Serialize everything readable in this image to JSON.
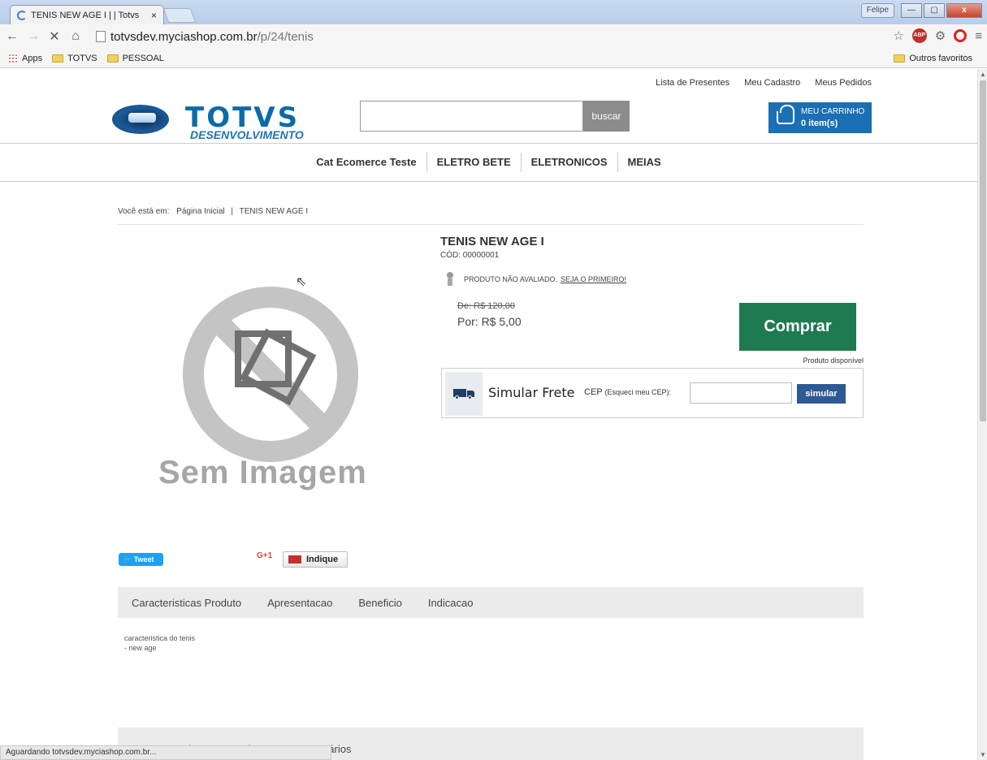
{
  "browser": {
    "tab_title": "TENIS NEW AGE I | | Totvs",
    "tab_close": "×",
    "user_button": "Felipe",
    "url_host": "totvsdev.myciashop.com.br",
    "url_path": "/p/24/tenis",
    "bookmarks": [
      "Apps",
      "TOTVS",
      "PESSOAL"
    ],
    "other_bookmarks": "Outros favoritos",
    "abp_label": "ABP",
    "status": "Aguardando totvsdev.myciashop.com.br..."
  },
  "header": {
    "links": [
      "Lista de Presentes",
      "Meu Cadastro",
      "Meus Pedidos"
    ],
    "logo_text": "TOTVS",
    "logo_sub": "DESENVOLVIMENTO",
    "search_value": "",
    "search_button": "buscar",
    "cart_title": "MEU CARRINHO",
    "cart_count": "0 item(s)"
  },
  "menu": [
    "Cat Ecomerce Teste",
    "ELETRO BETE",
    "ELETRONICOS",
    "MEIAS"
  ],
  "breadcrumb": {
    "prefix": "Você está em:",
    "home": "Página Inicial",
    "sep": "|",
    "current": "TENIS NEW AGE I"
  },
  "product": {
    "image_text": "Sem Imagem",
    "title": "TENIS NEW AGE I",
    "code": "CÓD: 00000001",
    "rating_text": "PRODUTO NÃO AVALIADO.",
    "rating_link": "SEJA O PRIMEIRO!",
    "price_old": "De: R$ 120,00",
    "price_new": "Por: R$ 5,00",
    "buy_button": "Comprar",
    "availability": "Produto disponível"
  },
  "shipping": {
    "title": "Simular Frete",
    "cep_label": "CEP",
    "cep_forgot": "(Esqueci meu CEP):",
    "cep_value": "",
    "button": "simular"
  },
  "social": {
    "tweet": "Tweet",
    "gplus": "G+1",
    "indique": "Indique"
  },
  "tabs": [
    "Caracteristicas Produto",
    "Apresentacao",
    "Beneficio",
    "Indicacao"
  ],
  "description": [
    "caracteristica do tenis",
    "- new age"
  ],
  "comment_tabs": [
    "Comente sobre este produto",
    "Comentários"
  ],
  "colors": {
    "accent_blue": "#1a6fb5",
    "buy_green": "#1e7a4f",
    "simular_blue": "#2d5a93",
    "tweet_blue": "#1da1f2"
  }
}
